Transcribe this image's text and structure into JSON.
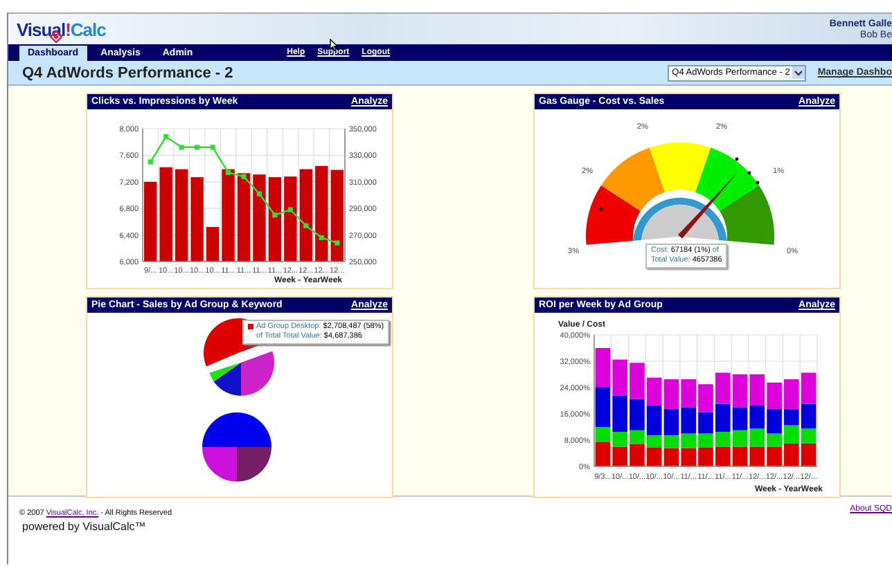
{
  "header": {
    "logo": [
      "Visual",
      "!",
      "Calc"
    ],
    "user": [
      "Bennett Galle",
      "Bob Be"
    ]
  },
  "nav": {
    "tabs": [
      {
        "label": "Dashboard",
        "selected": true
      },
      {
        "label": "Analysis",
        "selected": false
      },
      {
        "label": "Admin",
        "selected": false
      }
    ],
    "links": [
      "Help",
      "Support",
      "Logout"
    ]
  },
  "title_bar": {
    "title": "Q4 AdWords Performance - 2",
    "dashboard_select": "Q4 AdWords Performance - 2",
    "manage_link": "Manage Dashbo"
  },
  "panels": [
    {
      "kind": "combo",
      "title": "Clicks vs. Impressions by Week",
      "action": "Analyze",
      "chart_data": {
        "type": "bar",
        "xlabel": "Week - YearWeek",
        "categories": [
          "9/...",
          "10...",
          "10...",
          "10...",
          "10...",
          "11...",
          "11...",
          "11...",
          "11...",
          "12...",
          "12...",
          "12...",
          "12..."
        ],
        "ylim": [
          6000,
          8000
        ],
        "yticks": [
          {
            "value": 6000,
            "label": "6,000"
          },
          {
            "value": 6400,
            "label": "6,400"
          },
          {
            "value": 6800,
            "label": "6,800"
          },
          {
            "value": 7200,
            "label": "7,200"
          },
          {
            "value": 7600,
            "label": "7,600"
          },
          {
            "value": 8000,
            "label": "8,000"
          }
        ],
        "grid": true,
        "series": [
          {
            "color": "#cc0000",
            "values": [
              7200,
              7420,
              7390,
              7270,
              6520,
              7390,
              7330,
              7310,
              7270,
              7280,
              7390,
              7440,
              7380
            ]
          }
        ]
      },
      "overlay": {
        "chart_data": {
          "type": "line",
          "ylim": [
            250000,
            350000
          ],
          "yticks": [
            {
              "value": 250000,
              "label": "250,000"
            },
            {
              "value": 270000,
              "label": "270,000"
            },
            {
              "value": 290000,
              "label": "290,000"
            },
            {
              "value": 310000,
              "label": "310,000"
            },
            {
              "value": 330000,
              "label": "330,000"
            },
            {
              "value": 350000,
              "label": "350,000"
            }
          ],
          "series": [
            {
              "color": "#33dd33",
              "marker": true,
              "values": [
                325000,
                344000,
                336000,
                336000,
                336000,
                317000,
                314000,
                301000,
                285000,
                289000,
                277000,
                268000,
                264000
              ]
            }
          ]
        }
      }
    },
    {
      "kind": "gauge",
      "title": "Gas Gauge - Cost vs. Sales",
      "action": "Analyze",
      "labels": [
        "3%",
        "2%",
        "2%",
        "2%",
        "1%",
        "0%"
      ],
      "tooltip": [
        {
          "label": "Cost:",
          "value": "67184 (1%)",
          "tail": "of"
        },
        {
          "label": "Total Value:",
          "value": "4657386"
        }
      ]
    },
    {
      "kind": "pies",
      "title": "Pie Chart - Sales by Ad Group & Keyword",
      "action": "Analyze",
      "tooltip": {
        "color": "#dd0000",
        "lines": [
          {
            "label": "Ad Group Desktop:",
            "value": "$2,708,487 (58%)"
          },
          {
            "label": "of Total Total Value:",
            "value": "$4,687,386"
          }
        ]
      }
    },
    {
      "kind": "stacked",
      "title": "ROI per Week by Ad Group",
      "action": "Analyze",
      "chart_data": {
        "type": "bar",
        "stacked": true,
        "ylabel": "Value / Cost",
        "xlabel": "Week - YearWeek",
        "grid": true,
        "categories": [
          "9/3...",
          "10/...",
          "10/...",
          "10/...",
          "10/...",
          "11/...",
          "11/...",
          "11/...",
          "11/...",
          "12/...",
          "12/...",
          "12/...",
          "12/..."
        ],
        "ylim": [
          0,
          40000
        ],
        "yticks": [
          {
            "value": 0,
            "label": "0%"
          },
          {
            "value": 8000,
            "label": "8,000%"
          },
          {
            "value": 16000,
            "label": "16,000%"
          },
          {
            "value": 24000,
            "label": "24,000%"
          },
          {
            "value": 32000,
            "label": "32,000%"
          },
          {
            "value": 40000,
            "label": "40,000%"
          }
        ],
        "series": [
          {
            "color": "#dd0000",
            "values": [
              7500,
              6000,
              6800,
              5800,
              5500,
              5500,
              5800,
              6000,
              6000,
              6000,
              6000,
              7000,
              7000
            ]
          },
          {
            "color": "#00dd00",
            "values": [
              4500,
              4500,
              4200,
              3700,
              4000,
              4500,
              4200,
              4500,
              5000,
              5500,
              4000,
              5500,
              4500
            ]
          },
          {
            "color": "#0000dd",
            "values": [
              12000,
              11000,
              9500,
              9000,
              8000,
              8000,
              6500,
              8500,
              7000,
              7000,
              7500,
              5000,
              7500
            ]
          },
          {
            "color": "#dd00dd",
            "values": [
              12000,
              11000,
              11000,
              8500,
              9000,
              8500,
              8500,
              9500,
              10000,
              9500,
              8000,
              9000,
              9500
            ]
          }
        ]
      }
    }
  ],
  "footer": {
    "copyright": [
      "© 2007 ",
      "VisualCalc, Inc.",
      " - All Rights Reserved"
    ],
    "powered": "powered by VisualCalc™",
    "about": "About SQD"
  }
}
